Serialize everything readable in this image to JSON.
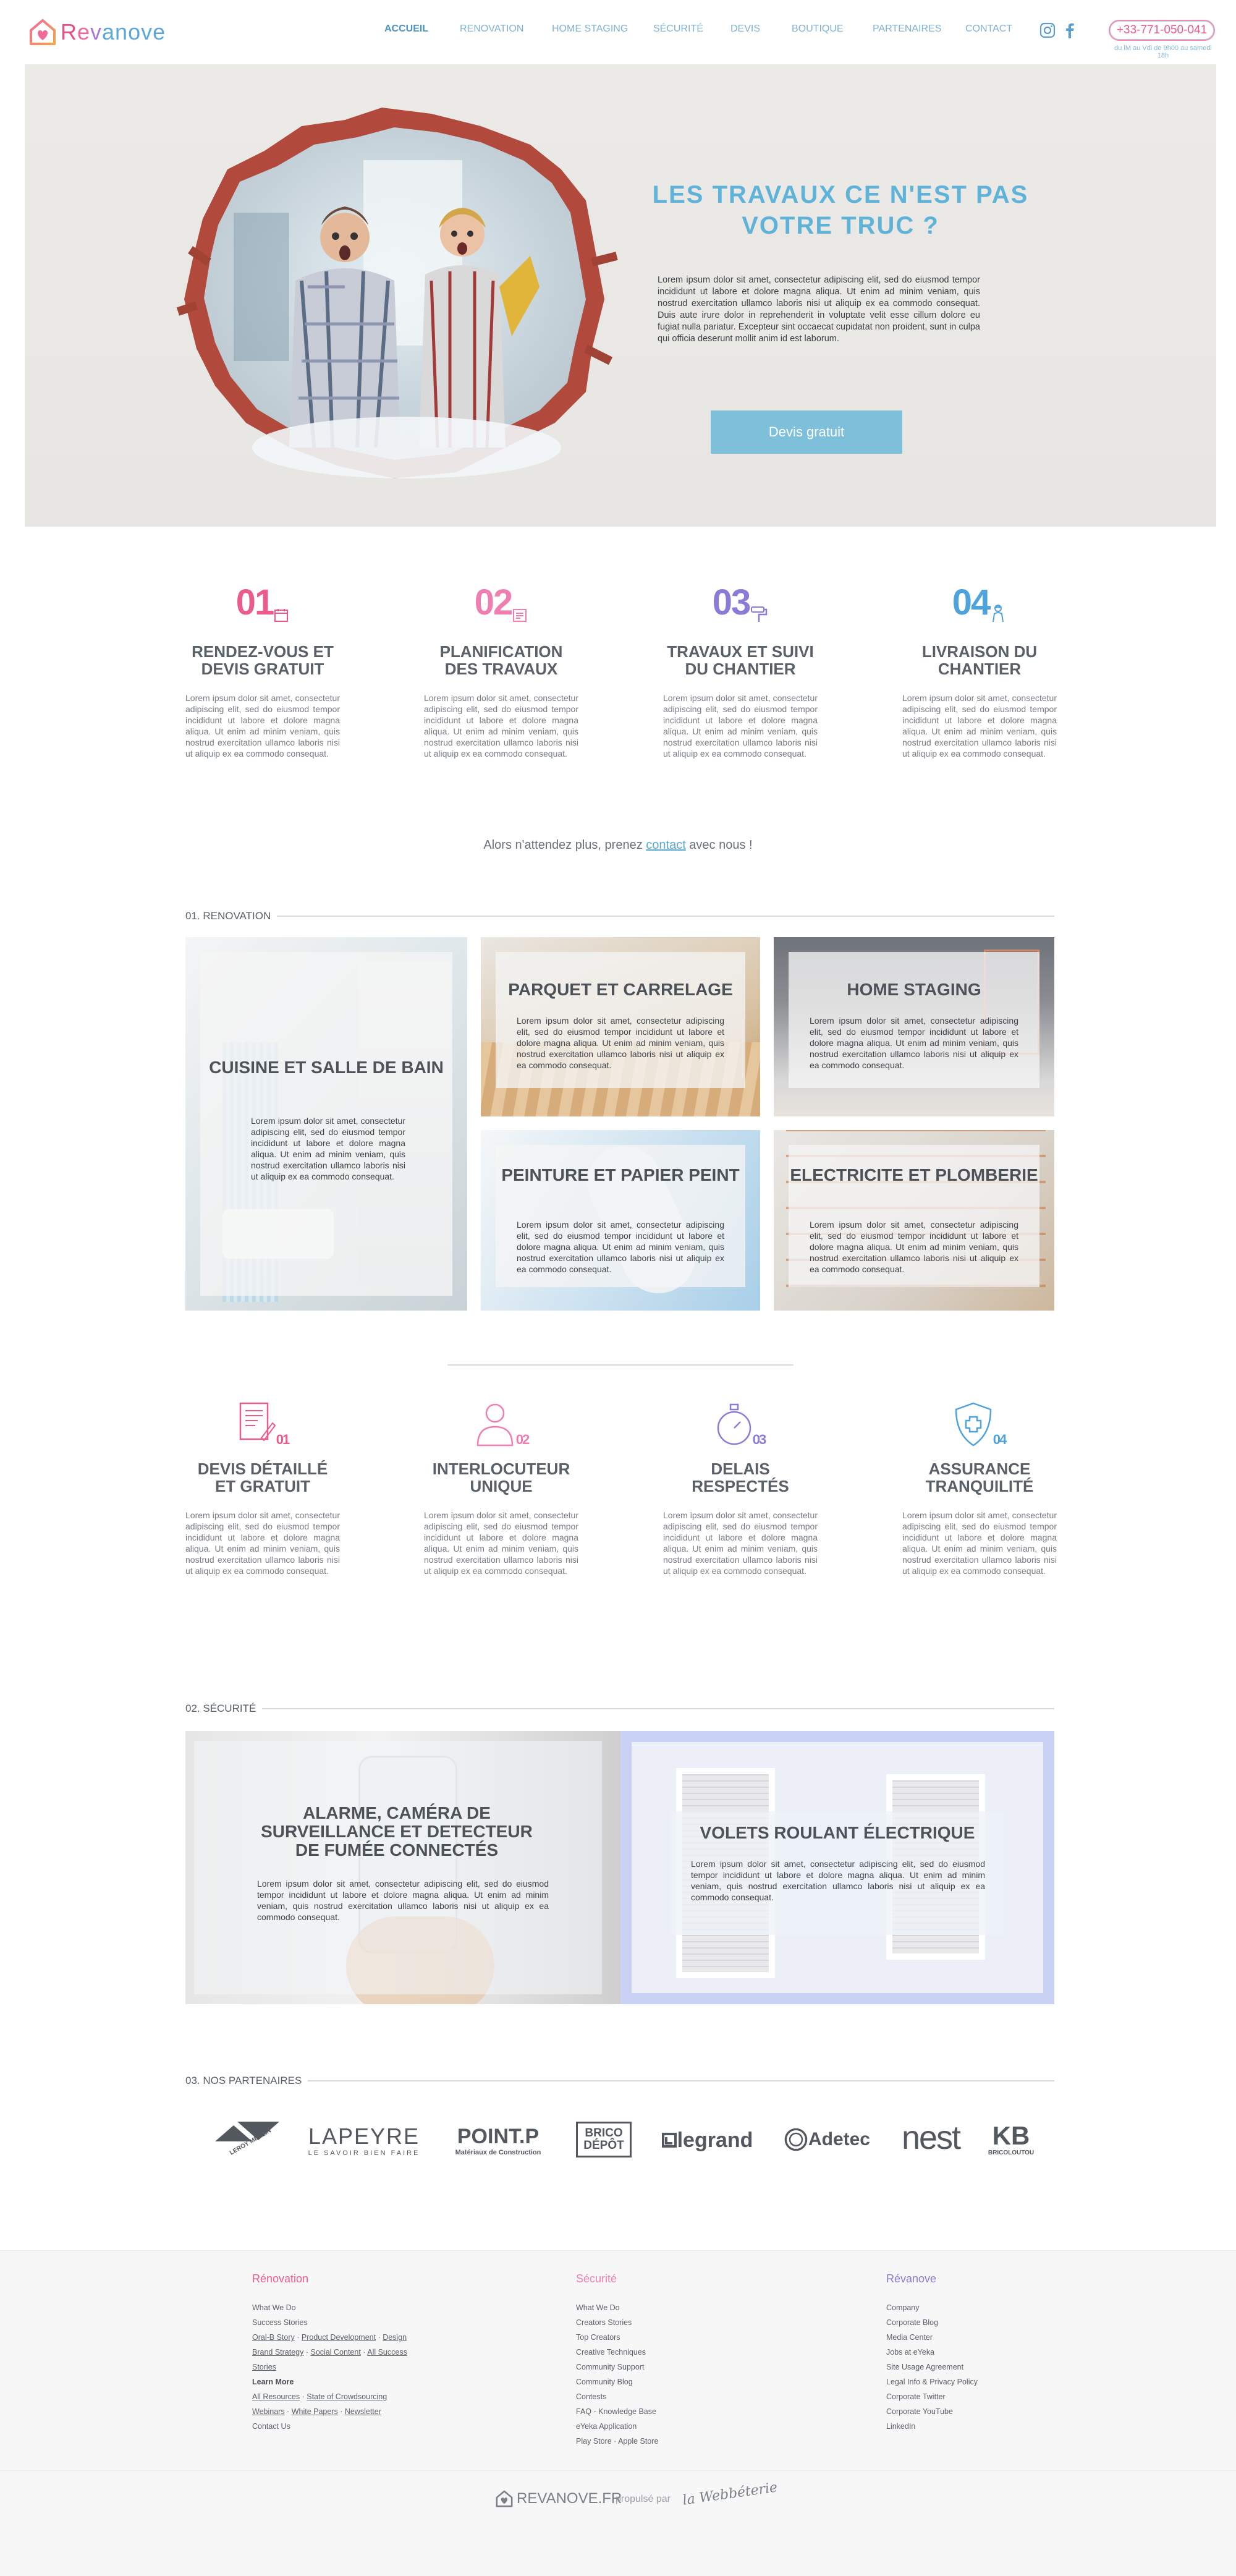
{
  "header": {
    "logo": {
      "letters": [
        "R",
        "e",
        "v",
        "anove"
      ]
    },
    "nav": [
      "ACCUEIL",
      "RENOVATION",
      "HOME STAGING",
      "SÉCURITÉ",
      "DEVIS",
      "BOUTIQUE",
      "PARTENAIRES",
      "CONTACT"
    ],
    "active_nav": "ACCUEIL",
    "phone": "+33-771-050-041",
    "phone_note": "du lM au Vdi de 9h00 au samedi 18h"
  },
  "hero": {
    "title": "LES TRAVAUX CE N'EST PAS VOTRE TRUC ?",
    "text": "Lorem ipsum dolor sit amet, consectetur adipiscing elit, sed do eiusmod tempor incididunt ut labore et dolore magna aliqua. Ut enim ad minim veniam, quis nostrud exercitation ullamco laboris nisi ut aliquip ex ea commodo consequat. Duis aute irure dolor in reprehenderit in voluptate velit esse cillum dolore eu fugiat nulla pariatur. Excepteur sint occaecat cupidatat non proident, sunt in culpa qui officia deserunt mollit anim id est laborum.",
    "button": "Devis gratuit"
  },
  "steps": [
    {
      "num": "01",
      "title": "RENDEZ-VOUS ET DEVIS GRATUIT",
      "text": "Lorem ipsum dolor sit amet, consectetur adipiscing elit, sed do eiusmod tempor incididunt ut labore et dolore magna aliqua. Ut enim ad minim veniam, quis nostrud exercitation ullamco laboris nisi ut aliquip ex ea commodo consequat.",
      "color": "#e95c8c",
      "icon": "calendar-icon"
    },
    {
      "num": "02",
      "title": "PLANIFICATION DES TRAVAUX",
      "text": "Lorem ipsum dolor sit amet, consectetur adipiscing elit, sed do eiusmod tempor incididunt ut labore et dolore magna aliqua. Ut enim ad minim veniam, quis nostrud exercitation ullamco laboris nisi ut aliquip ex ea commodo consequat.",
      "color": "#ef7fb0",
      "icon": "planning-icon"
    },
    {
      "num": "03",
      "title": "TRAVAUX ET SUIVI DU CHANTIER",
      "text": "Lorem ipsum dolor sit amet, consectetur adipiscing elit, sed do eiusmod tempor incididunt ut labore et dolore magna aliqua. Ut enim ad minim veniam, quis nostrud exercitation ullamco laboris nisi ut aliquip ex ea commodo consequat.",
      "color": "#8b7bd6",
      "icon": "paint-roller-icon"
    },
    {
      "num": "04",
      "title": "LIVRAISON DU CHANTIER",
      "text": "Lorem ipsum dolor sit amet, consectetur adipiscing elit, sed do eiusmod tempor incididunt ut labore et dolore magna aliqua. Ut enim ad minim veniam, quis nostrud exercitation ullamco laboris nisi ut aliquip ex ea commodo consequat.",
      "color": "#4fa3dc",
      "icon": "worker-icon"
    }
  ],
  "cta": {
    "before": "Alors n'attendez plus, prenez ",
    "link": "contact",
    "after": " avec nous !"
  },
  "renovation": {
    "heading": "01. RENOVATION",
    "tiles": [
      {
        "title": "CUISINE ET SALLE DE BAIN",
        "text": "Lorem ipsum dolor sit amet, consectetur adipiscing elit, sed do eiusmod tempor incididunt ut labore et dolore magna aliqua. Ut enim ad minim veniam, quis nostrud exercitation ullamco laboris nisi ut aliquip ex ea commodo consequat."
      },
      {
        "title": "PARQUET ET CARRELAGE",
        "text": "Lorem ipsum dolor sit amet, consectetur adipiscing elit, sed do eiusmod tempor incididunt ut labore et dolore magna aliqua. Ut enim ad minim veniam, quis nostrud exercitation ullamco laboris nisi ut aliquip ex ea commodo consequat."
      },
      {
        "title": "HOME STAGING",
        "text": "Lorem ipsum dolor sit amet, consectetur adipiscing elit, sed do eiusmod tempor incididunt ut labore et dolore magna aliqua. Ut enim ad minim veniam, quis nostrud exercitation ullamco laboris nisi ut aliquip ex ea commodo consequat."
      },
      {
        "title": "PEINTURE ET PAPIER PEINT",
        "text": "Lorem ipsum dolor sit amet, consectetur adipiscing elit, sed do eiusmod tempor incididunt ut labore et dolore magna aliqua. Ut enim ad minim veniam, quis nostrud exercitation ullamco laboris nisi ut aliquip ex ea commodo consequat."
      },
      {
        "title": "ELECTRICITE ET PLOMBERIE",
        "text": "Lorem ipsum dolor sit amet, consectetur adipiscing elit, sed do eiusmod tempor incididunt ut labore et dolore magna aliqua. Ut enim ad minim veniam, quis nostrud exercitation ullamco laboris nisi ut aliquip ex ea commodo consequat."
      }
    ]
  },
  "advantages": [
    {
      "num": "01",
      "title": "DEVIS DÉTAILLÉ ET GRATUIT",
      "text": "Lorem ipsum dolor sit amet, consectetur adipiscing elit, sed do eiusmod tempor incididunt ut labore et dolore magna aliqua. Ut enim ad minim veniam, quis nostrud exercitation ullamco laboris nisi ut aliquip ex ea commodo consequat.",
      "color": "#e95c8c",
      "icon": "document-icon"
    },
    {
      "num": "02",
      "title": "INTERLOCUTEUR UNIQUE",
      "text": "Lorem ipsum dolor sit amet, consectetur adipiscing elit, sed do eiusmod tempor incididunt ut labore et dolore magna aliqua. Ut enim ad minim veniam, quis nostrud exercitation ullamco laboris nisi ut aliquip ex ea commodo consequat.",
      "color": "#ef7fb0",
      "icon": "person-icon"
    },
    {
      "num": "03",
      "title": "DELAIS RESPECTÉS",
      "text": "Lorem ipsum dolor sit amet, consectetur adipiscing elit, sed do eiusmod tempor incididunt ut labore et dolore magna aliqua. Ut enim ad minim veniam, quis nostrud exercitation ullamco laboris nisi ut aliquip ex ea commodo consequat.",
      "color": "#8b7bd6",
      "icon": "stopwatch-icon"
    },
    {
      "num": "04",
      "title": "ASSURANCE TRANQUILITÉ",
      "text": "Lorem ipsum dolor sit amet, consectetur adipiscing elit, sed do eiusmod tempor incididunt ut labore et dolore magna aliqua. Ut enim ad minim veniam, quis nostrud exercitation ullamco laboris nisi ut aliquip ex ea commodo consequat.",
      "color": "#4fa3dc",
      "icon": "shield-icon"
    }
  ],
  "security": {
    "heading": "02. SÉCURITÉ",
    "tiles": [
      {
        "title": "ALARME, CAMÉRA DE SURVEILLANCE ET DETECTEUR DE FUMÉE CONNECTÉS",
        "text": "Lorem ipsum dolor sit amet, consectetur adipiscing elit, sed do eiusmod tempor incididunt ut labore et dolore magna aliqua. Ut enim ad minim veniam, quis nostrud exercitation ullamco laboris nisi ut aliquip ex ea commodo consequat."
      },
      {
        "title": "VOLETS ROULANT ÉLECTRIQUE",
        "text": "Lorem ipsum dolor sit amet, consectetur adipiscing elit, sed do eiusmod tempor incididunt ut labore et dolore magna aliqua. Ut enim ad minim veniam, quis nostrud exercitation ullamco laboris nisi ut aliquip ex ea commodo consequat."
      }
    ]
  },
  "partners": {
    "heading": "03. NOS PARTENAIRES",
    "logos": [
      "LEROY MERLIN",
      "LAPEYRE",
      "LE SAVOIR BIEN FAIRE",
      "POINT.P",
      "Matériaux de Construction",
      "BRICO DÉPÔT",
      "legrand",
      "Adetec",
      "nest",
      "KB",
      "BRICOLOUTOU"
    ]
  },
  "footer": {
    "col1": {
      "title": "Rénovation",
      "links": [
        "What We Do",
        "Success Stories",
        "Oral-B Story",
        "Product Development",
        "Design",
        "Brand Strategy",
        "Social Content",
        "All Success",
        "Stories",
        "Learn More",
        "All Resources",
        "State of Crowdsourcing",
        "Webinars",
        "White Papers",
        "Newsletter",
        "Contact Us"
      ]
    },
    "col2": {
      "title": "Sécurité",
      "links": [
        "What We Do",
        "Creators Stories",
        "Top Creators",
        "Creative Techniques",
        "Community Support",
        "Community Blog",
        "Contests",
        "FAQ - Knowledge Base",
        "eYeka Application",
        "Play Store",
        "Apple Store"
      ]
    },
    "col3": {
      "title": "Révanove",
      "links": [
        "Company",
        "Corporate Blog",
        "Media Center",
        "Jobs at eYeka",
        "Site Usage Agreement",
        "Legal Info & Privacy Policy",
        "Corporate Twitter",
        "Corporate YouTube",
        "LinkedIn"
      ]
    },
    "brand": "REVANOVE.FR",
    "powered": "propulsé par",
    "agency": "la Webbéterie"
  }
}
